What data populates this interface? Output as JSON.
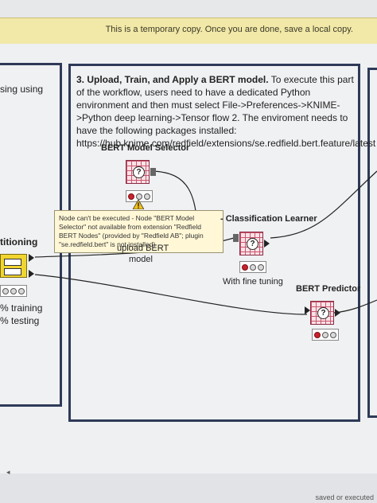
{
  "banner": {
    "text": "This is a temporary copy. Once you are done, save a local copy."
  },
  "annotation": {
    "heading": "3. Upload, Train, and Apply a BERT model.",
    "body": "To execute this part of the workflow, users need to have a dedicated Python environment and then must select File->Preferences->KNIME->Python deep learning->Tensor flow 2. The enviroment needs to have the following packages installed:",
    "url": "https://hub.knime.com/redfield/extensions/se.redfield.bert.feature/latest"
  },
  "left_fragments": {
    "sing_using": "sing using",
    "titioning": "titioning",
    "training": "% training",
    "testing": "% testing"
  },
  "nodes": {
    "bert_selector": {
      "label": "BERT Model Selector",
      "sub": "upload BERT\nmodel"
    },
    "classification_learner": {
      "label": "Classification Learner",
      "prefix": "-",
      "sub": "With fine tuning"
    },
    "bert_predictor": {
      "label": "BERT Predictor"
    }
  },
  "tooltip": {
    "text": "Node can't be executed - Node \"BERT Model Selector\" not available from extension \"Redfield BERT Nodes\" (provided by \"Redfield AB\"; plugin \"se.redfield.bert\" is not installed)"
  },
  "status_bar": {
    "corner": "saved or executed"
  },
  "colors": {
    "banner": "#f2e8a7",
    "annotation_border": "#2e3a57",
    "node_pink": "#fbe2e7",
    "node_yellow": "#f1d52f",
    "status_red": "#c8232c"
  }
}
